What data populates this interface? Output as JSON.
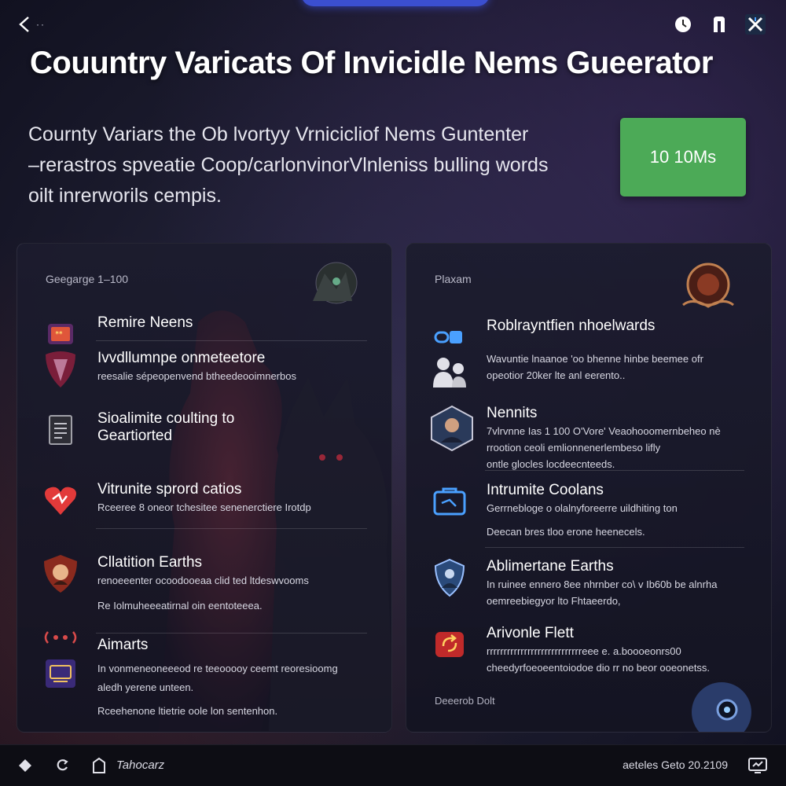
{
  "header": {
    "title": "Couuntry Varicats Of Invicidle Nems Gueerator",
    "description_lines": [
      "Cournty Variars the Ob lvortyy Vrnicicliof Nems Guntenter",
      "–rerastros spveatie Coop/carlonvinorVlnleniss bulling words",
      "oilt inrerworils cempis."
    ],
    "cta_label": "10 10Ms"
  },
  "left_panel": {
    "label": "Geegarge 1–100",
    "items": [
      {
        "title": "Remire Neens",
        "sub": [],
        "icon": "banner-icon"
      },
      {
        "title": "Ivvdllumnpe onmeteetore",
        "sub": [
          "reesalie sépeopenvend btheedeooimnerbos"
        ],
        "icon": "pick-icon"
      },
      {
        "title": "Sioalimite coulting to Geartiorted",
        "sub": [],
        "icon": "document-icon"
      },
      {
        "title": "Vitrunite sprord catios",
        "sub": [
          "Rceeree 8 oneor tchesitee senenerctiere Irotdp"
        ],
        "icon": "heart-icon"
      },
      {
        "title": "Cllatition Earths",
        "sub": [
          "renoeeenter ocoodooeaa clid ted ltdeswvooms",
          "",
          "Re Iolmuheeeatirnal oin eentoteeea."
        ],
        "icon": "emblem-icon"
      },
      {
        "title": "Aimarts",
        "sub": [
          "In vonmeneoneeeod re teeooooy ceemt reoresioomg",
          "aledh yerene unteen.",
          "",
          "Rceehenone ltietrie oole lon sentenhon."
        ],
        "icon": "screen-icon"
      }
    ]
  },
  "right_panel": {
    "label": "Plaxam",
    "items": [
      {
        "title": "Roblrayntfien nhoelwards",
        "sub": [],
        "icon": "link-icon"
      },
      {
        "title": "",
        "sub": [
          "Wavuntie lnaanoe 'oo bhenne hinbe beemee ofr",
          "opeotior 20ker lte anl eerento.."
        ],
        "icon": "users-icon"
      },
      {
        "title": "Nennits",
        "sub": [
          "7vlrvnne Ias 1 100 O'Vore' Veaohooomernbeheo nè",
          "rrootion ceoli emlionnenerlembeso lifly",
          "ontle glocles locdeecnteeds."
        ],
        "icon": "portrait-icon"
      },
      {
        "title": "Intrumite Coolans",
        "sub": [
          "Gerrnebloge o olalnyforeerre uildhiting ton",
          "",
          "Deecan bres tloo erone heenecels."
        ],
        "icon": "toolbox-icon"
      },
      {
        "title": "Ablimertane Earths",
        "sub": [
          "In ruinee ennero 8ee nhrnber co\\ v Ib60b be alnrha",
          "oemreebiegyor lto Fhtaeerdo,"
        ],
        "icon": "shield-icon"
      },
      {
        "title": "Arivonle Flett",
        "sub": [
          "rrrrrrrrrrrrrrrrrrrrrrrrrrrreee e. a.boooeonrs00",
          "cheedyrfoeoeentoiodoe dio rr no beor ooeonetss."
        ],
        "icon": "refresh-icon"
      }
    ],
    "footer_label": "Deeerob Dolt"
  },
  "bottombar": {
    "app_label": "Tahocarz",
    "right_text": "aeteles  Geto  20.2109"
  },
  "colors": {
    "accent_green": "#4caa57",
    "accent_blue": "#3b4fd0",
    "background": "#1a1a2c"
  }
}
